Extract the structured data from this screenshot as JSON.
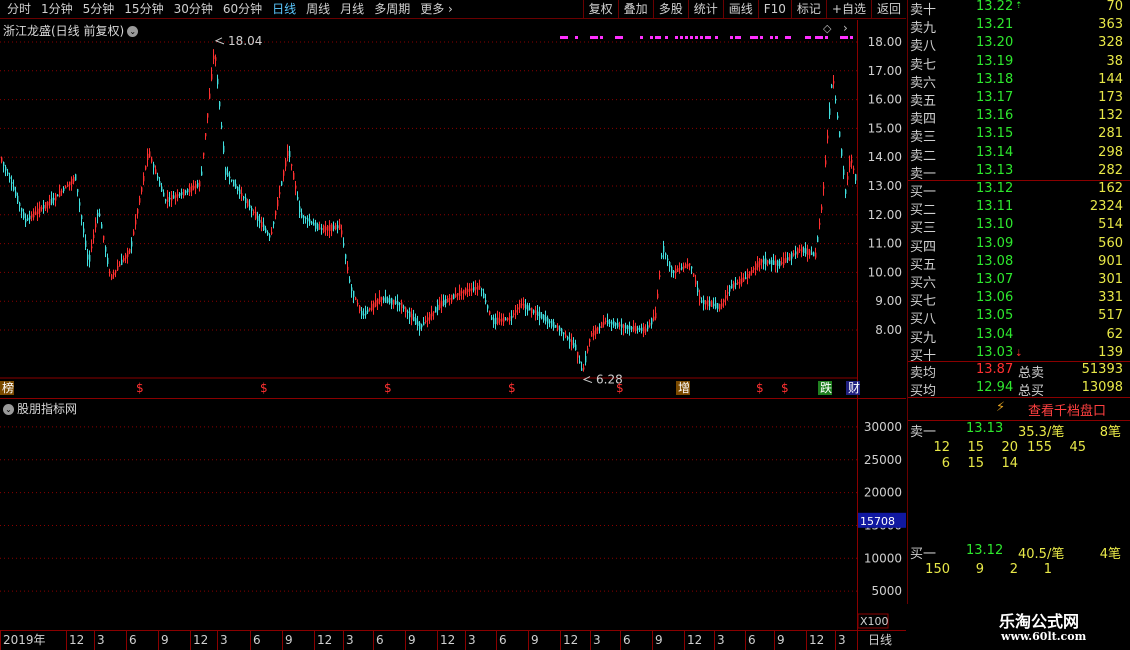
{
  "toolbar": {
    "periods": [
      "分时",
      "1分钟",
      "5分钟",
      "15分钟",
      "30分钟",
      "60分钟",
      "日线",
      "周线",
      "月线",
      "多周期",
      "更多"
    ],
    "active_period": "日线",
    "actions": [
      "复权",
      "叠加",
      "多股",
      "统计",
      "画线",
      "F10",
      "标记",
      "+自选",
      "返回"
    ]
  },
  "main_chart": {
    "title": "浙江龙盛(日线 前复权)",
    "high_label": "18.04",
    "low_label": "6.28",
    "y_ticks": [
      "18.00",
      "17.00",
      "16.00",
      "15.00",
      "14.00",
      "13.00",
      "12.00",
      "11.00",
      "10.00",
      "9.00",
      "8.00"
    ],
    "event_markers": [
      "榜",
      "$",
      "$",
      "$",
      "$",
      "$",
      "增",
      "$",
      "$",
      "跌",
      "财"
    ]
  },
  "indicator": {
    "title": "股朋指标网",
    "y_ticks": [
      "30000",
      "25000",
      "20000",
      "15000",
      "10000",
      "5000"
    ],
    "current_value": "15708",
    "unit": "X100",
    "x_labels": [
      "2019年",
      "12",
      "3",
      "6",
      "9",
      "12",
      "3",
      "6",
      "9",
      "12",
      "3",
      "6",
      "9",
      "12",
      "3",
      "6",
      "9",
      "12",
      "3",
      "6",
      "9",
      "12",
      "3",
      "6",
      "9",
      "12",
      "3"
    ],
    "period_label": "日线"
  },
  "quote": {
    "asks": [
      {
        "label": "卖十",
        "price": "13.22",
        "vol": "70",
        "flag": "up"
      },
      {
        "label": "卖九",
        "price": "13.21",
        "vol": "363"
      },
      {
        "label": "卖八",
        "price": "13.20",
        "vol": "328"
      },
      {
        "label": "卖七",
        "price": "13.19",
        "vol": "38"
      },
      {
        "label": "卖六",
        "price": "13.18",
        "vol": "144"
      },
      {
        "label": "卖五",
        "price": "13.17",
        "vol": "173"
      },
      {
        "label": "卖四",
        "price": "13.16",
        "vol": "132"
      },
      {
        "label": "卖三",
        "price": "13.15",
        "vol": "281"
      },
      {
        "label": "卖二",
        "price": "13.14",
        "vol": "298"
      },
      {
        "label": "卖一",
        "price": "13.13",
        "vol": "282"
      }
    ],
    "bids": [
      {
        "label": "买一",
        "price": "13.12",
        "vol": "162"
      },
      {
        "label": "买二",
        "price": "13.11",
        "vol": "2324"
      },
      {
        "label": "买三",
        "price": "13.10",
        "vol": "514"
      },
      {
        "label": "买四",
        "price": "13.09",
        "vol": "560"
      },
      {
        "label": "买五",
        "price": "13.08",
        "vol": "901"
      },
      {
        "label": "买六",
        "price": "13.07",
        "vol": "301"
      },
      {
        "label": "买七",
        "price": "13.06",
        "vol": "331"
      },
      {
        "label": "买八",
        "price": "13.05",
        "vol": "517"
      },
      {
        "label": "买九",
        "price": "13.04",
        "vol": "62"
      },
      {
        "label": "买十",
        "price": "13.03",
        "vol": "139",
        "flag": "down"
      }
    ],
    "sell_avg_label": "卖均",
    "sell_avg": "13.87",
    "total_sell_label": "总卖",
    "total_sell": "51393",
    "buy_avg_label": "买均",
    "buy_avg": "12.94",
    "total_buy_label": "总买",
    "total_buy": "13098",
    "thousand_link": "查看千档盘口",
    "ask1_label": "卖一",
    "ask1_price": "13.13",
    "ask1_per": "35.3/笔",
    "ask1_count": "8笔",
    "ask1_orders_row1": [
      "12",
      "15",
      "20",
      "155",
      "45"
    ],
    "ask1_orders_row2": [
      "6",
      "15",
      "14"
    ],
    "bid1_label": "买一",
    "bid1_price": "13.12",
    "bid1_per": "40.5/笔",
    "bid1_count": "4笔",
    "bid1_orders_row1": [
      "150",
      "9",
      "2",
      "1"
    ]
  },
  "watermark": {
    "line1": "乐淘公式网",
    "line2": "www.60lt.com"
  },
  "colors": {
    "up": "#ff3030",
    "down": "#40e0e0",
    "grid": "#8a0000",
    "price_green": "#2ee82e",
    "volume_yellow": "#e8e848",
    "magenta": "#ff30ff",
    "active_tab": "#5ac8ff"
  }
}
